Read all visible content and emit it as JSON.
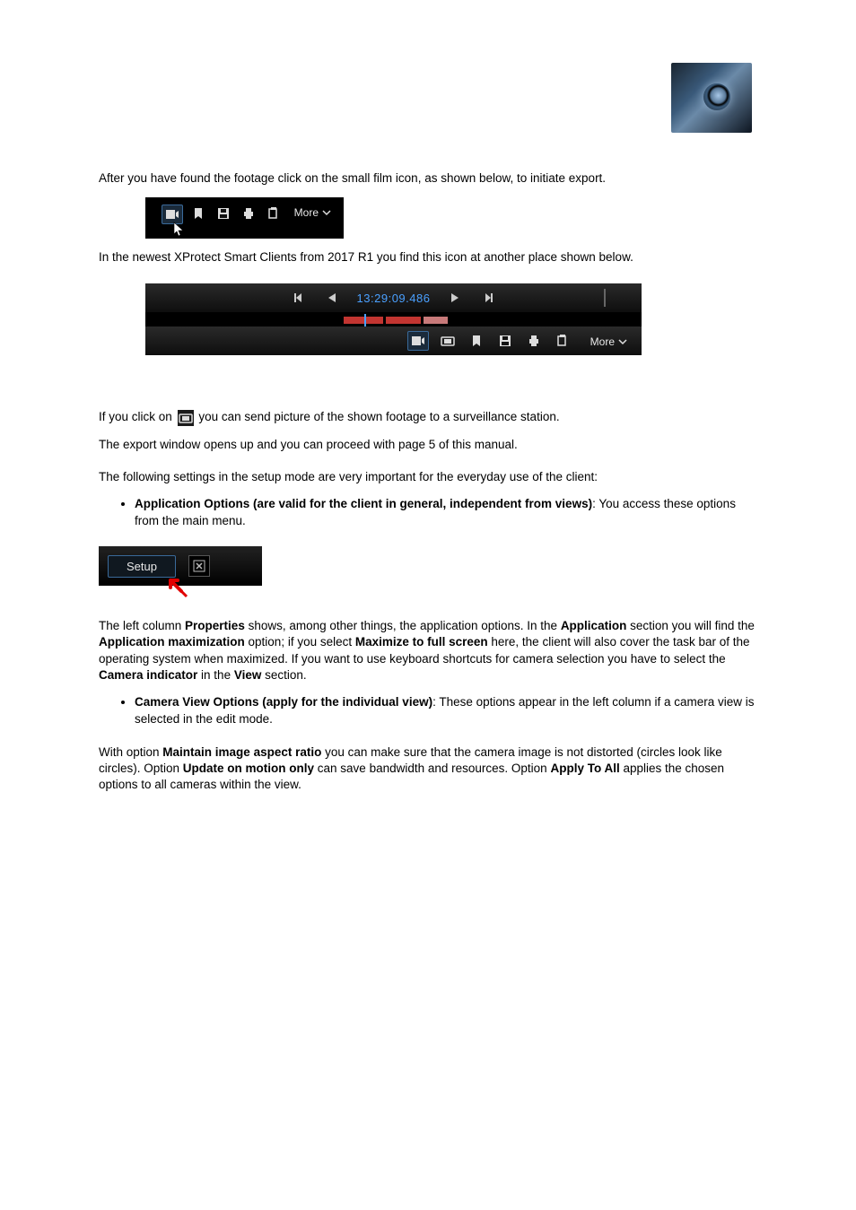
{
  "paragraphs": {
    "p1": "After you have found the footage click on the small film icon, as shown below, to initiate export.",
    "p2": "In the newest XProtect Smart Clients from 2017 R1 you find this icon at another place shown below.",
    "p3": "If you click on",
    "p3b": "you can send picture of the shown footage to a surveillance station.",
    "p4": "The export window opens up and you can proceed with page 5 of this manual.",
    "p5": "The following settings in the setup mode are very important for the everyday use of the client:",
    "li1_strong": "Application Options (are valid for the client in general, independent from views)",
    "li1_rest": ": You access these options from the main menu.",
    "p6": "The left column ",
    "p6b": "Properties",
    "p6c": " shows, among other things, the application options. In the ",
    "p6d": "Application",
    "p6e": " section you will find the ",
    "p6f": "Application maximization",
    "p6g": " option; if you select ",
    "p6h": "Maximize to full screen",
    "p6i": " here, the client will also cover the task bar of the operating system when maximized. If you want to use keyboard shortcuts for camera selection you have to select the ",
    "p6j": "Camera indicator",
    "p6k": " in the ",
    "p6l": "View",
    "p6m": " section.",
    "li2_strong": "Camera View Options (apply for the individual view)",
    "li2_rest": ": These options appear in the left column if a camera view is selected in the edit mode.",
    "p7a": "With option ",
    "p7b": "Maintain image aspect ratio",
    "p7c": " you can make sure that the camera image is not distorted (circles look like circles). Option ",
    "p7d": "Update on motion only",
    "p7e": " can save bandwidth and resources. Option ",
    "p7f": "Apply To All",
    "p7g": " applies the chosen options to all cameras within the view."
  },
  "toolbar_small": {
    "more_label": "More"
  },
  "playback": {
    "time": "13:29:09.486",
    "more_label": "More"
  },
  "setup": {
    "button_label": "Setup"
  }
}
